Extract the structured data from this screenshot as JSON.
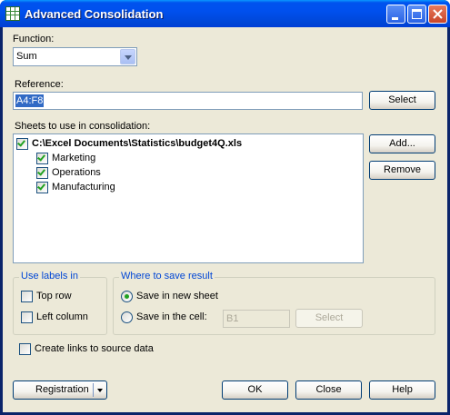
{
  "window": {
    "title": "Advanced Consolidation",
    "icon": "spreadsheet-icon",
    "accent": "#0053ee"
  },
  "function": {
    "label": "Function:",
    "value": "Sum"
  },
  "reference": {
    "label": "Reference:",
    "value": "A4:F8",
    "select_label": "Select"
  },
  "sheets": {
    "label": "Sheets to use in consolidation:",
    "file": "C:\\Excel Documents\\Statistics\\budget4Q.xls",
    "items": [
      {
        "label": "Marketing",
        "checked": true
      },
      {
        "label": "Operations",
        "checked": true
      },
      {
        "label": "Manufacturing",
        "checked": true
      }
    ],
    "add_label": "Add...",
    "remove_label": "Remove"
  },
  "labels_group": {
    "title": "Use labels in",
    "top_row": "Top row",
    "left_column": "Left column"
  },
  "save_group": {
    "title": "Where to save result",
    "new_sheet": "Save in new sheet",
    "in_cell": "Save in the cell:",
    "cell_value": "B1",
    "select_label": "Select"
  },
  "links": {
    "label": "Create links to source data"
  },
  "footer": {
    "registration": "Registration",
    "ok": "OK",
    "close": "Close",
    "help": "Help"
  }
}
